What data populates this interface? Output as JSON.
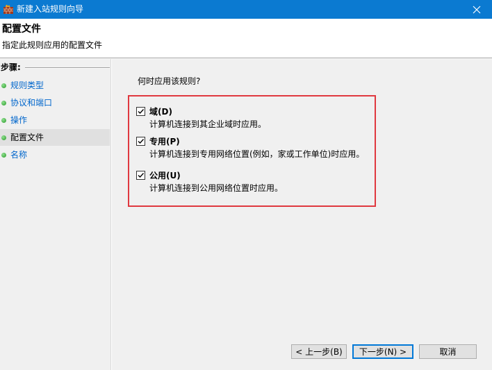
{
  "window": {
    "title": "新建入站规则向导",
    "app_icon": "firewall-wall-icon",
    "close_icon": "close-icon"
  },
  "header": {
    "title": "配置文件",
    "subtitle": "指定此规则应用的配置文件"
  },
  "sidebar": {
    "steps_label": "步骤:",
    "items": [
      {
        "label": "规则类型",
        "current": false
      },
      {
        "label": "协议和端口",
        "current": false
      },
      {
        "label": "操作",
        "current": false
      },
      {
        "label": "配置文件",
        "current": true
      },
      {
        "label": "名称",
        "current": false
      }
    ]
  },
  "main": {
    "question": "何时应用该规则?",
    "options": [
      {
        "title": "域(D)",
        "description": "计算机连接到其企业域时应用。",
        "checked": true
      },
      {
        "title": "专用(P)",
        "description": "计算机连接到专用网络位置(例如，家或工作单位)时应用。",
        "checked": true
      },
      {
        "title": "公用(U)",
        "description": "计算机连接到公用网络位置时应用。",
        "checked": true
      }
    ]
  },
  "buttons": {
    "back": "< 上一步(B)",
    "next": "下一步(N) >",
    "cancel": "取消"
  },
  "colors": {
    "titlebar": "#0b7ad1",
    "highlight": "#e0383f",
    "link": "#0066cc",
    "step_dot": "#2a9a2a"
  }
}
